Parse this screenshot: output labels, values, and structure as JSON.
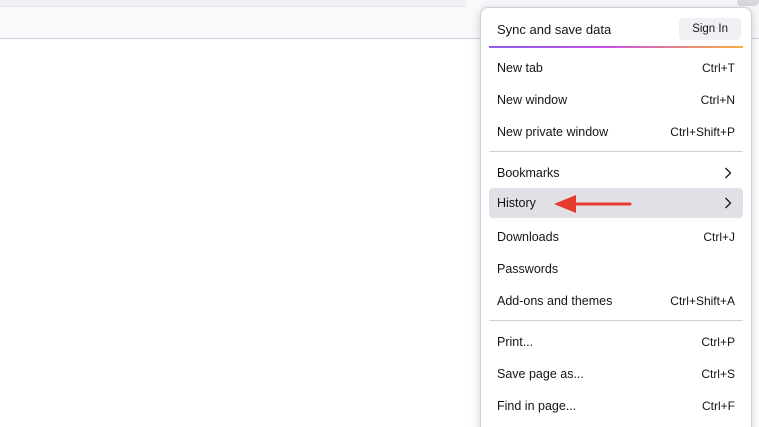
{
  "sync": {
    "label": "Sync and save data",
    "signin_label": "Sign In"
  },
  "menu": {
    "group1": [
      {
        "label": "New tab",
        "shortcut": "Ctrl+T"
      },
      {
        "label": "New window",
        "shortcut": "Ctrl+N"
      },
      {
        "label": "New private window",
        "shortcut": "Ctrl+Shift+P"
      }
    ],
    "group2": [
      {
        "label": "Bookmarks",
        "icon": "chevron-right-icon"
      },
      {
        "label": "History",
        "icon": "chevron-right-icon",
        "hovered": true
      },
      {
        "label": "Downloads",
        "shortcut": "Ctrl+J"
      },
      {
        "label": "Passwords"
      },
      {
        "label": "Add-ons and themes",
        "shortcut": "Ctrl+Shift+A"
      }
    ],
    "group3": [
      {
        "label": "Print...",
        "shortcut": "Ctrl+P"
      },
      {
        "label": "Save page as...",
        "shortcut": "Ctrl+S"
      },
      {
        "label": "Find in page...",
        "shortcut": "Ctrl+F"
      }
    ]
  },
  "annotation": {
    "icon": "red-arrow-left-icon",
    "color": "#e8392e"
  },
  "colors": {
    "hover": "#e0e0e6",
    "text": "#15141a",
    "separator": "#cfcfd8"
  }
}
